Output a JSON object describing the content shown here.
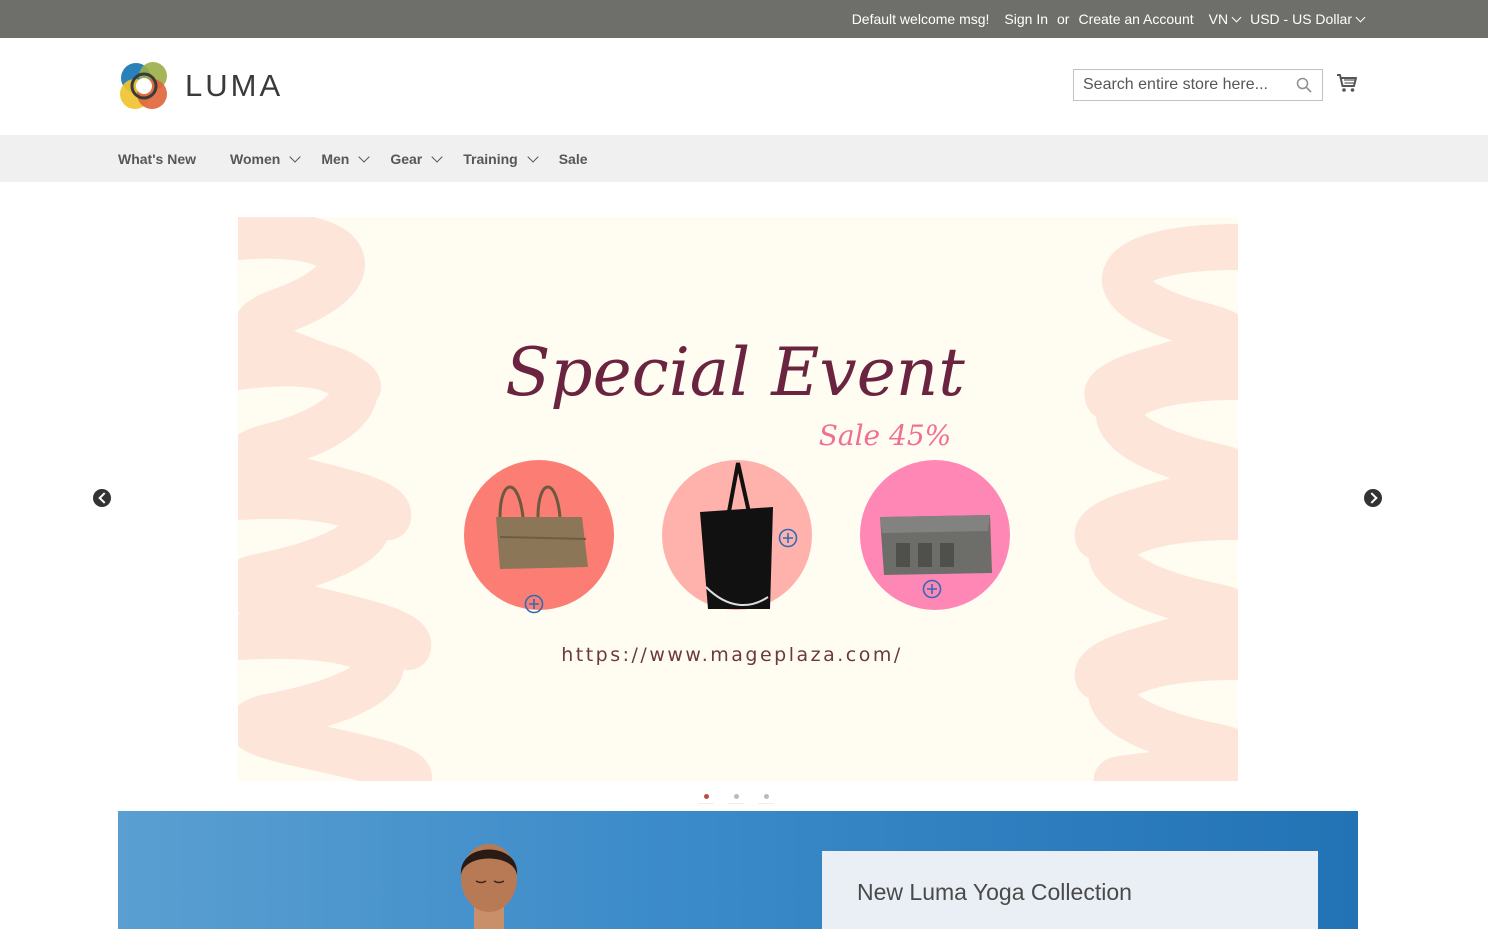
{
  "topbar": {
    "welcome": "Default welcome msg!",
    "sign_in": "Sign In",
    "or": "or",
    "create_account": "Create an Account",
    "language": "VN",
    "currency": "USD - US Dollar"
  },
  "header": {
    "logo_text": "LUMA",
    "search_placeholder": "Search entire store here...",
    "icons": {
      "search": "search-icon",
      "cart": "cart-icon"
    }
  },
  "nav": {
    "items": [
      {
        "label": "What's New",
        "has_submenu": false
      },
      {
        "label": "Women",
        "has_submenu": true
      },
      {
        "label": "Men",
        "has_submenu": true
      },
      {
        "label": "Gear",
        "has_submenu": true
      },
      {
        "label": "Training",
        "has_submenu": true
      },
      {
        "label": "Sale",
        "has_submenu": false
      }
    ]
  },
  "slider": {
    "headline": "Special Event",
    "sub": "Sale 45%",
    "url": "https://www.mageplaza.com/",
    "slide_count": 3,
    "active_slide": 1
  },
  "promo": {
    "title": "New Luma Yoga Collection"
  },
  "colors": {
    "topbar": "#6e6e6b",
    "nav_bg": "#f0f0f0",
    "headline": "#6b2440",
    "sale": "#ef6f95",
    "url_text": "#6b3a3a",
    "circle1": "#fb7d74",
    "circle2": "#ffb2ac",
    "circle3": "#ff87b5",
    "stroke_bg": "#fde6d9"
  }
}
